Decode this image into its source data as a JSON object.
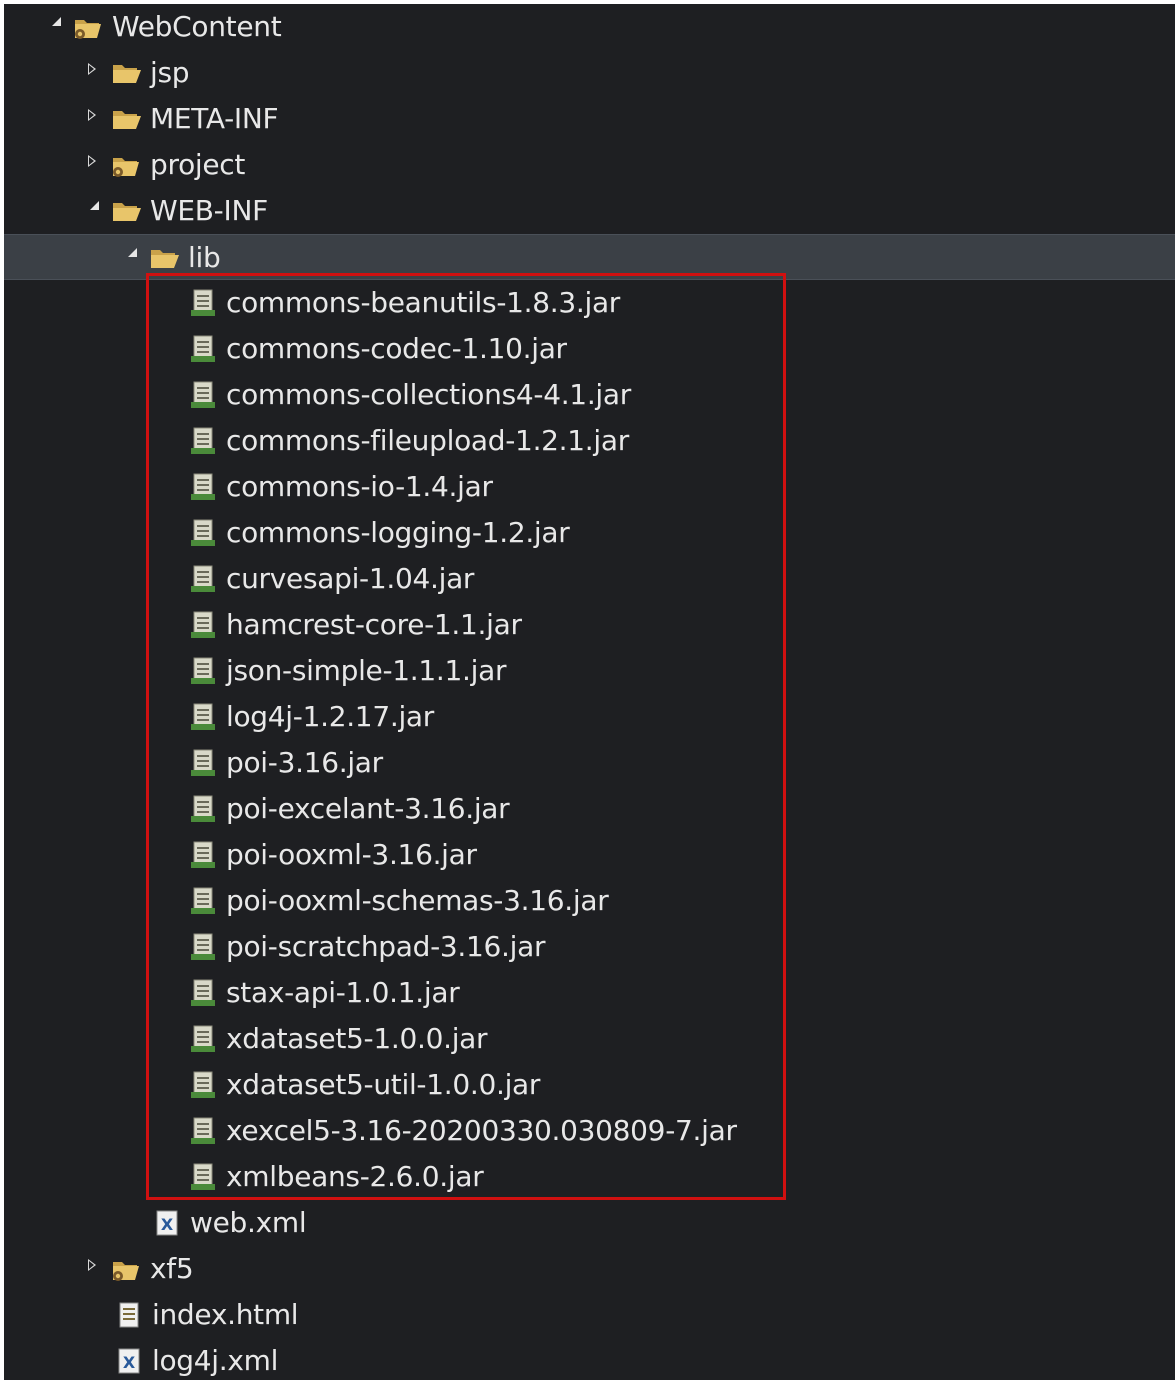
{
  "explorer": {
    "selected_path": "WebContent/WEB-INF/lib",
    "nodes": [
      {
        "label": "WebContent",
        "type": "project-folder",
        "expander": "expanded"
      },
      {
        "label": "jsp",
        "type": "folder",
        "expander": "collapsed"
      },
      {
        "label": "META-INF",
        "type": "folder",
        "expander": "collapsed"
      },
      {
        "label": "project",
        "type": "project-folder",
        "expander": "collapsed"
      },
      {
        "label": "WEB-INF",
        "type": "folder",
        "expander": "expanded"
      },
      {
        "label": "lib",
        "type": "folder",
        "expander": "expanded"
      },
      {
        "label": "commons-beanutils-1.8.3.jar",
        "type": "jar"
      },
      {
        "label": "commons-codec-1.10.jar",
        "type": "jar"
      },
      {
        "label": "commons-collections4-4.1.jar",
        "type": "jar"
      },
      {
        "label": "commons-fileupload-1.2.1.jar",
        "type": "jar"
      },
      {
        "label": "commons-io-1.4.jar",
        "type": "jar"
      },
      {
        "label": "commons-logging-1.2.jar",
        "type": "jar"
      },
      {
        "label": "curvesapi-1.04.jar",
        "type": "jar"
      },
      {
        "label": "hamcrest-core-1.1.jar",
        "type": "jar"
      },
      {
        "label": "json-simple-1.1.1.jar",
        "type": "jar"
      },
      {
        "label": "log4j-1.2.17.jar",
        "type": "jar"
      },
      {
        "label": "poi-3.16.jar",
        "type": "jar"
      },
      {
        "label": "poi-excelant-3.16.jar",
        "type": "jar"
      },
      {
        "label": "poi-ooxml-3.16.jar",
        "type": "jar"
      },
      {
        "label": "poi-ooxml-schemas-3.16.jar",
        "type": "jar"
      },
      {
        "label": "poi-scratchpad-3.16.jar",
        "type": "jar"
      },
      {
        "label": "stax-api-1.0.1.jar",
        "type": "jar"
      },
      {
        "label": "xdataset5-1.0.0.jar",
        "type": "jar"
      },
      {
        "label": "xdataset5-util-1.0.0.jar",
        "type": "jar"
      },
      {
        "label": "xexcel5-3.16-20200330.030809-7.jar",
        "type": "jar"
      },
      {
        "label": "xmlbeans-2.6.0.jar",
        "type": "jar"
      },
      {
        "label": "web.xml",
        "type": "xml"
      },
      {
        "label": "xf5",
        "type": "project-folder",
        "expander": "collapsed"
      },
      {
        "label": "index.html",
        "type": "html"
      },
      {
        "label": "log4j.xml",
        "type": "xml"
      }
    ]
  },
  "colors": {
    "background": "#1e1f22",
    "selection": "#3b4046",
    "text": "#e8e8e8",
    "highlight_border": "#d01010",
    "folder": "#e8c56a",
    "jar": "#d9d9c9"
  }
}
